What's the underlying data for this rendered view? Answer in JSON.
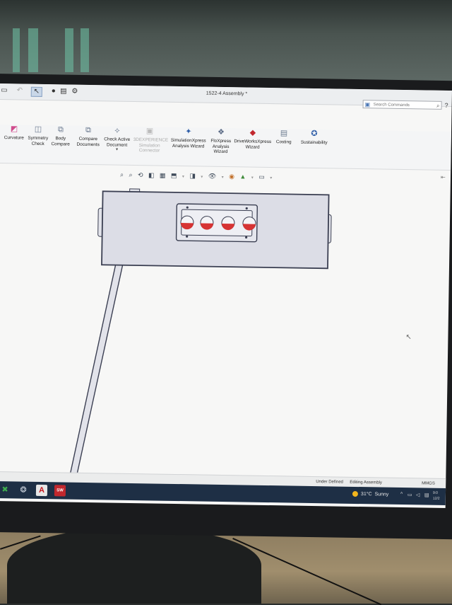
{
  "window": {
    "title": "1522-4 Assembly *"
  },
  "search": {
    "placeholder": "Search Commands"
  },
  "ribbon": {
    "items": [
      {
        "label": "Curvature",
        "icon": "curvature-icon",
        "enabled": true
      },
      {
        "label": "Symmetry Check",
        "icon": "symmetry-check-icon",
        "enabled": true
      },
      {
        "label": "Body Compare",
        "icon": "body-compare-icon",
        "enabled": true
      },
      {
        "label": "Compare Documents",
        "icon": "compare-documents-icon",
        "enabled": true
      },
      {
        "label": "Check Active Document",
        "icon": "check-active-document-icon",
        "enabled": true
      },
      {
        "label": "3DEXPERIENCE Simulation Connector",
        "icon": "simulation-connector-icon",
        "enabled": false
      },
      {
        "label": "SimulationXpress Analysis Wizard",
        "icon": "simulationxpress-icon",
        "enabled": true
      },
      {
        "label": "FloXpress Analysis Wizard",
        "icon": "floxpress-icon",
        "enabled": true
      },
      {
        "label": "DriveWorksXpress Wizard",
        "icon": "driveworksxpress-icon",
        "enabled": true
      },
      {
        "label": "Costing",
        "icon": "costing-icon",
        "enabled": true
      },
      {
        "label": "Sustainability",
        "icon": "sustainability-icon",
        "enabled": true
      }
    ]
  },
  "status": {
    "state": "Under Defined",
    "mode": "Editing Assembly",
    "units": "MMGS"
  },
  "taskbar": {
    "solidworks_label": "SW",
    "acrobat_label": "A",
    "weather_temp": "31°C",
    "weather_text": "Sunny",
    "time": "9:0",
    "date": "12/2"
  },
  "colors": {
    "accent": "#2f5ea8",
    "taskbar": "#1e2f45",
    "model_fill": "#dcdde6",
    "model_edge": "#3b3f52",
    "indicator_red": "#d63333"
  }
}
